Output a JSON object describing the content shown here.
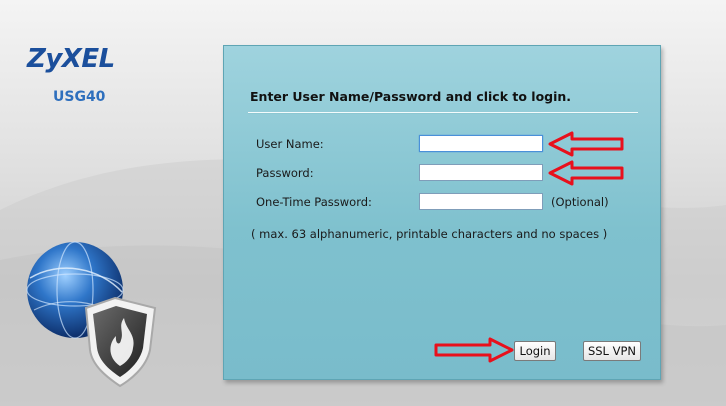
{
  "brand": {
    "name": "ZyXEL",
    "model": "USG40"
  },
  "login": {
    "title": "Enter User Name/Password and click to login.",
    "username_label": "User Name:",
    "username_value": "",
    "password_label": "Password:",
    "password_value": "",
    "otp_label": "One-Time Password:",
    "otp_value": "",
    "otp_note": "(Optional)",
    "hint": "( max. 63 alphanumeric, printable characters and no spaces )",
    "login_button": "Login",
    "sslvpn_button": "SSL VPN"
  },
  "annotations": {
    "arrow_color": "#e8101c"
  },
  "icons": {
    "globe": "globe-icon",
    "shield": "shield-flame-icon"
  }
}
